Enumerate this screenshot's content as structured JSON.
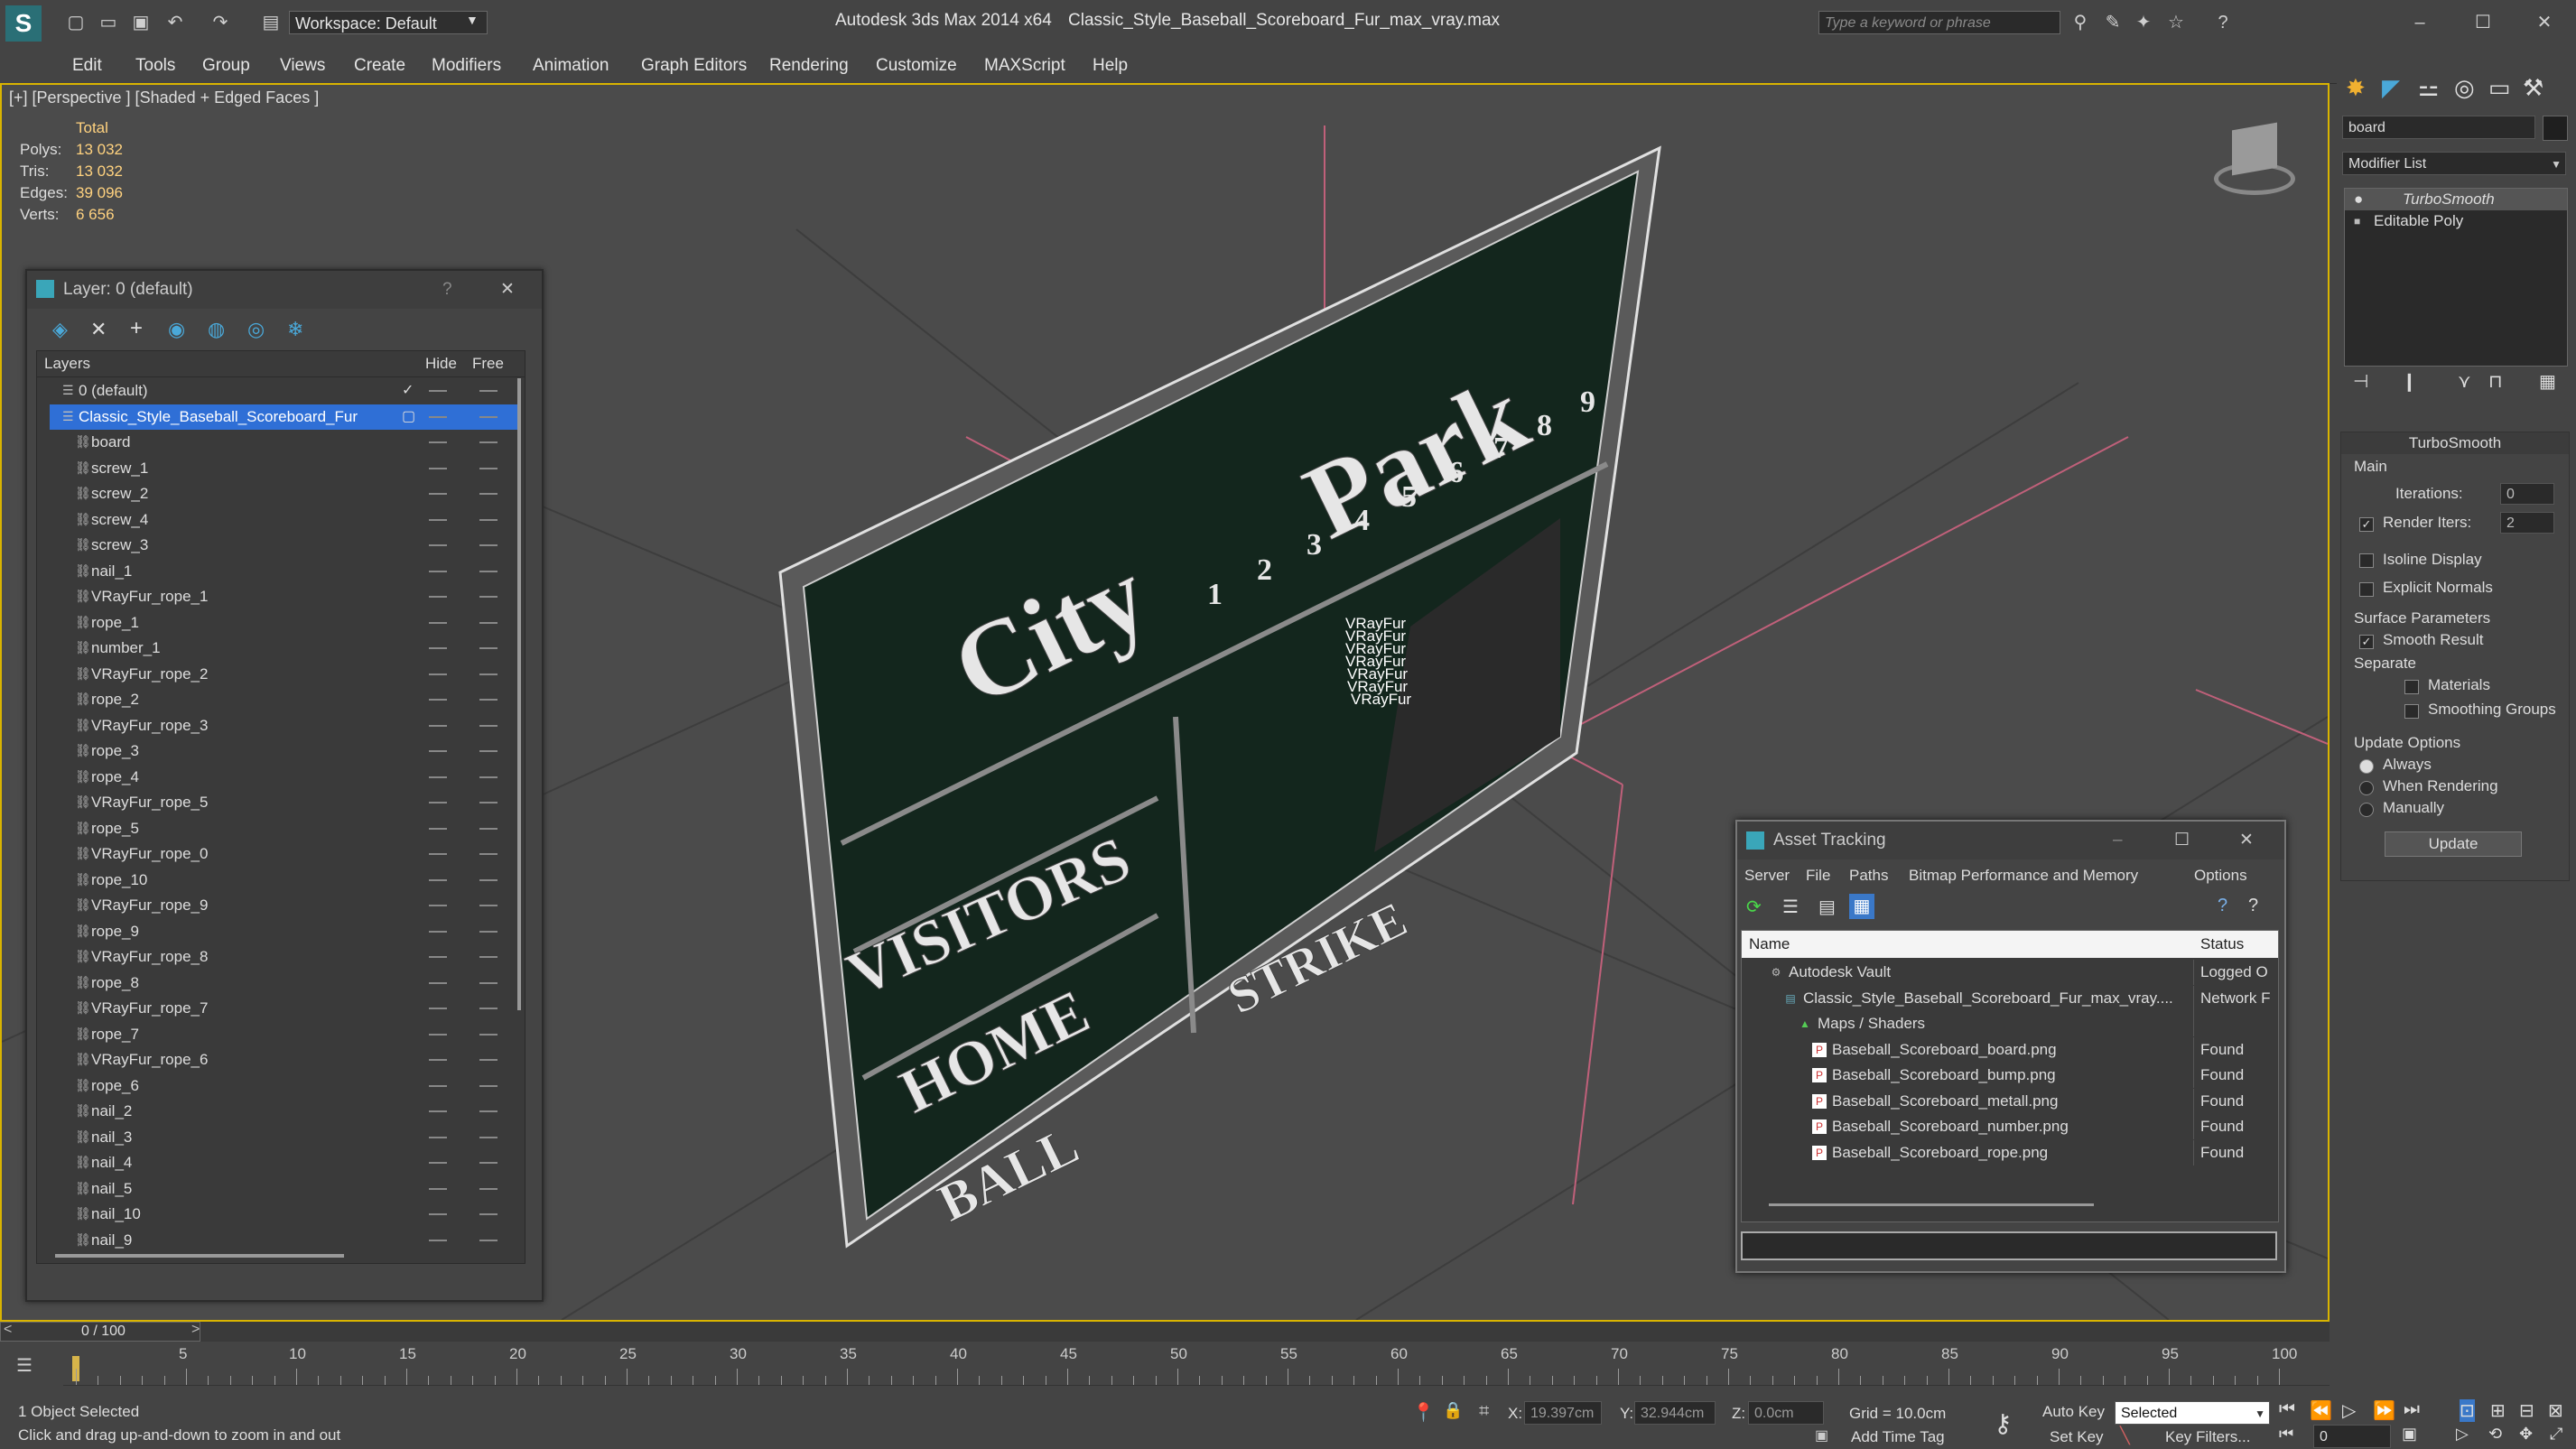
{
  "titlebar": {
    "workspace_label": "Workspace: Default",
    "app_title": "Autodesk 3ds Max  2014 x64",
    "file_title": "Classic_Style_Baseball_Scoreboard_Fur_max_vray.max",
    "search_placeholder": "Type a keyword or phrase"
  },
  "menu": [
    "Edit",
    "Tools",
    "Group",
    "Views",
    "Create",
    "Modifiers",
    "Animation",
    "Graph Editors",
    "Rendering",
    "Customize",
    "MAXScript",
    "Help"
  ],
  "viewport": {
    "label": "[+] [Perspective ] [Shaded + Edged Faces ]",
    "stats_header": "Total",
    "stats": [
      {
        "label": "Polys:",
        "value": "13 032"
      },
      {
        "label": "Tris:",
        "value": "13 032"
      },
      {
        "label": "Edges:",
        "value": "39 096"
      },
      {
        "label": "Verts:",
        "value": "6 656"
      }
    ],
    "fur_label": "VRayFur",
    "board_text": {
      "city": "City",
      "park": "Park",
      "visitors": "VISITORS",
      "home": "HOME",
      "ball": "BALL",
      "strike": "STRIKE",
      "innings": [
        "1",
        "2",
        "3",
        "4",
        "5",
        "6",
        "7",
        "8",
        "9"
      ]
    }
  },
  "layer_dialog": {
    "title": "Layer: 0 (default)",
    "help": "?",
    "columns": {
      "layers": "Layers",
      "hide": "Hide",
      "free": "Free"
    },
    "layers": [
      {
        "name": "0 (default)",
        "level": 0
      },
      {
        "name": "Classic_Style_Baseball_Scoreboard_Fur",
        "level": 0,
        "selected": true
      }
    ],
    "objects": [
      "board",
      "screw_1",
      "screw_2",
      "screw_4",
      "screw_3",
      "nail_1",
      "VRayFur_rope_1",
      "rope_1",
      "number_1",
      "VRayFur_rope_2",
      "rope_2",
      "VRayFur_rope_3",
      "rope_3",
      "rope_4",
      "VRayFur_rope_5",
      "rope_5",
      "VRayFur_rope_0",
      "rope_10",
      "VRayFur_rope_9",
      "rope_9",
      "VRayFur_rope_8",
      "rope_8",
      "VRayFur_rope_7",
      "rope_7",
      "VRayFur_rope_6",
      "rope_6",
      "nail_2",
      "nail_3",
      "nail_4",
      "nail_5",
      "nail_10",
      "nail_9"
    ]
  },
  "command_panel": {
    "object_name": "board",
    "modifier_list": "Modifier List",
    "stack": [
      "TurboSmooth",
      "Editable Poly"
    ],
    "rollout_title": "TurboSmooth",
    "main_label": "Main",
    "iterations_label": "Iterations:",
    "iterations_value": "0",
    "render_iters_label": "Render Iters:",
    "render_iters_value": "2",
    "isoline": "Isoline Display",
    "explicit_normals": "Explicit Normals",
    "surface_params": "Surface Parameters",
    "smooth_result": "Smooth Result",
    "separate": "Separate",
    "materials": "Materials",
    "smoothing_groups": "Smoothing Groups",
    "update_options": "Update Options",
    "always": "Always",
    "when_rendering": "When Rendering",
    "manually": "Manually",
    "update_button": "Update"
  },
  "asset_dialog": {
    "title": "Asset Tracking",
    "menu": [
      "Server",
      "File",
      "Paths",
      "Bitmap Performance and Memory",
      "Options"
    ],
    "columns": {
      "name": "Name",
      "status": "Status"
    },
    "rows": [
      {
        "name": "Autodesk Vault",
        "status": "Logged O",
        "indent": 1
      },
      {
        "name": "Classic_Style_Baseball_Scoreboard_Fur_max_vray....",
        "status": "Network F",
        "indent": 2
      },
      {
        "name": "Maps / Shaders",
        "status": "",
        "indent": 3
      },
      {
        "name": "Baseball_Scoreboard_board.png",
        "status": "Found",
        "indent": 4
      },
      {
        "name": "Baseball_Scoreboard_bump.png",
        "status": "Found",
        "indent": 4
      },
      {
        "name": "Baseball_Scoreboard_metall.png",
        "status": "Found",
        "indent": 4
      },
      {
        "name": "Baseball_Scoreboard_number.png",
        "status": "Found",
        "indent": 4
      },
      {
        "name": "Baseball_Scoreboard_rope.png",
        "status": "Found",
        "indent": 4
      }
    ]
  },
  "timeline": {
    "frame_counter": "0 / 100",
    "ticks": [
      "5",
      "10",
      "15",
      "20",
      "25",
      "30",
      "35",
      "40",
      "45",
      "50",
      "55",
      "60",
      "65",
      "70",
      "75",
      "80",
      "85",
      "90",
      "95",
      "100"
    ]
  },
  "status": {
    "selection": "1 Object Selected",
    "prompt": "Click and drag up-and-down to zoom in and out",
    "x_label": "X:",
    "x_value": "19.397cm",
    "y_label": "Y:",
    "y_value": "32.944cm",
    "z_label": "Z:",
    "z_value": "0.0cm",
    "grid": "Grid = 10.0cm",
    "add_time_tag": "Add Time Tag",
    "auto_key": "Auto Key",
    "set_key": "Set Key",
    "selected_option": "Selected",
    "key_filters": "Key Filters...",
    "frame_value": "0"
  }
}
